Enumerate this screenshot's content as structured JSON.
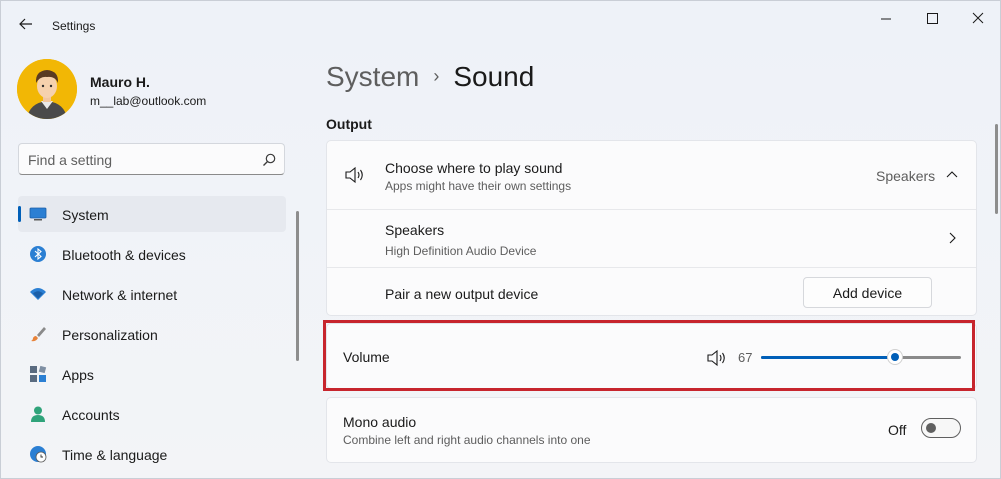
{
  "app": {
    "title": "Settings"
  },
  "user": {
    "name": "Mauro H.",
    "email": "m__lab@outlook.com"
  },
  "search": {
    "placeholder": "Find a setting"
  },
  "sidebar": {
    "items": [
      {
        "label": "System",
        "icon": "system-icon",
        "active": true
      },
      {
        "label": "Bluetooth & devices",
        "icon": "bluetooth-icon"
      },
      {
        "label": "Network & internet",
        "icon": "wifi-icon"
      },
      {
        "label": "Personalization",
        "icon": "brush-icon"
      },
      {
        "label": "Apps",
        "icon": "apps-icon"
      },
      {
        "label": "Accounts",
        "icon": "person-icon"
      },
      {
        "label": "Time & language",
        "icon": "clock-globe-icon"
      }
    ]
  },
  "breadcrumb": {
    "parent": "System",
    "separator": "›",
    "current": "Sound"
  },
  "output": {
    "section_title": "Output",
    "choose": {
      "title": "Choose where to play sound",
      "subtitle": "Apps might have their own settings",
      "value": "Speakers"
    },
    "device": {
      "title": "Speakers",
      "subtitle": "High Definition Audio Device"
    },
    "pair": {
      "title": "Pair a new output device",
      "button": "Add device"
    }
  },
  "volume": {
    "label": "Volume",
    "value": "67",
    "level": 0.67
  },
  "mono": {
    "title": "Mono audio",
    "subtitle": "Combine left and right audio channels into one",
    "state_label": "Off"
  },
  "colors": {
    "accent": "#005fb8",
    "highlight": "#c7252d",
    "avatar_bg": "#f2b705"
  }
}
